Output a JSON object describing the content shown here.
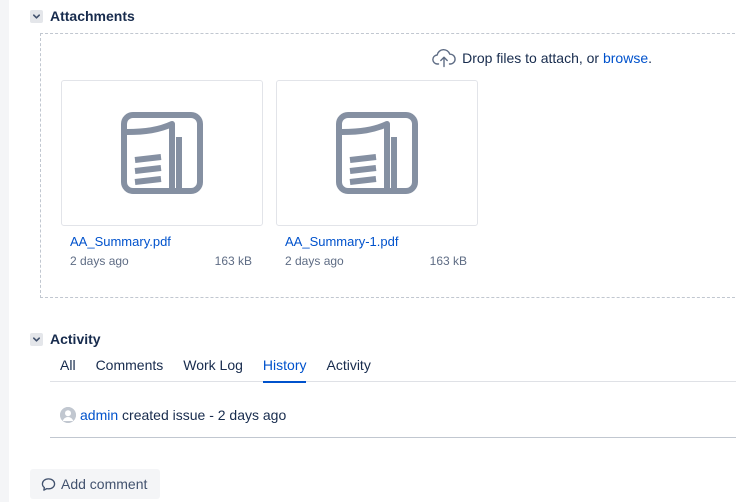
{
  "attachments": {
    "title": "Attachments",
    "drop_text": "Drop files to attach, or ",
    "browse_label": "browse",
    "drop_suffix": ".",
    "files": [
      {
        "name": "AA_Summary.pdf",
        "age": "2 days ago",
        "size": "163 kB",
        "icon": "pdf-file-icon"
      },
      {
        "name": "AA_Summary-1.pdf",
        "age": "2 days ago",
        "size": "163 kB",
        "icon": "pdf-file-icon"
      }
    ]
  },
  "activity": {
    "title": "Activity",
    "tabs": [
      {
        "label": "All",
        "active": false
      },
      {
        "label": "Comments",
        "active": false
      },
      {
        "label": "Work Log",
        "active": false
      },
      {
        "label": "History",
        "active": true
      },
      {
        "label": "Activity",
        "active": false
      }
    ],
    "history": {
      "user": "admin",
      "action": " created issue - 2 days ago"
    }
  },
  "comment": {
    "add_label": "Add comment"
  },
  "colors": {
    "link": "#0052cc",
    "text": "#172b4d",
    "muted": "#5e6c84",
    "icon_gray": "#8590a2"
  }
}
